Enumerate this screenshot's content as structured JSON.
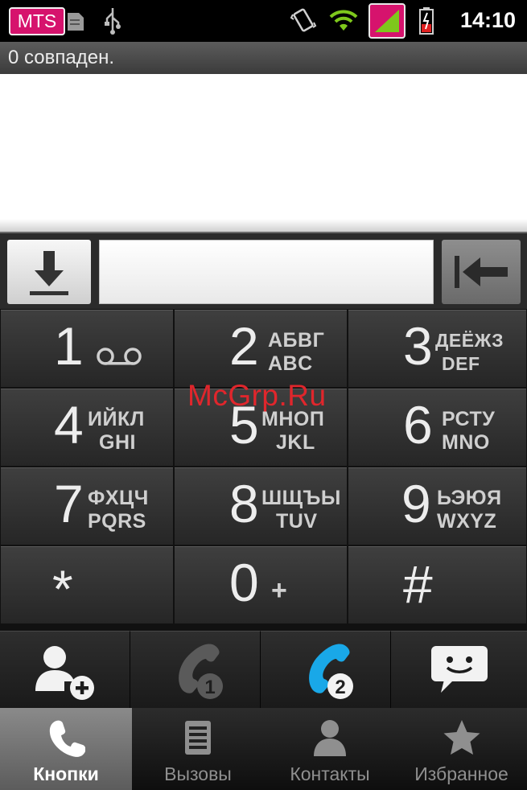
{
  "status_bar": {
    "carrier": "MTS",
    "time": "14:10",
    "icons": [
      "sd-card-icon",
      "usb-icon",
      "vibrate-icon",
      "wifi-icon",
      "signal-icon",
      "battery-charging-icon"
    ]
  },
  "search": {
    "matches_label": "0 совпаден.",
    "number_value": ""
  },
  "input_row": {
    "left_icon": "hide-keypad-icon",
    "right_icon": "backspace-icon"
  },
  "keypad": [
    {
      "digit": "1",
      "icon": "voicemail-icon"
    },
    {
      "digit": "2",
      "cyrillic": "АБВГ",
      "latin": "ABC"
    },
    {
      "digit": "3",
      "cyrillic": "ДЕЁЖЗ",
      "latin": "DEF"
    },
    {
      "digit": "4",
      "cyrillic": "ИЙКЛ",
      "latin": "GHI"
    },
    {
      "digit": "5",
      "cyrillic": "МНОП",
      "latin": "JKL"
    },
    {
      "digit": "6",
      "cyrillic": "РСТУ",
      "latin": "MNO"
    },
    {
      "digit": "7",
      "cyrillic": "ФХЦЧ",
      "latin": "PQRS"
    },
    {
      "digit": "8",
      "cyrillic": "ШЩЪЫ",
      "latin": "TUV"
    },
    {
      "digit": "9",
      "cyrillic": "ЬЭЮЯ",
      "latin": "WXYZ"
    },
    {
      "digit": "*"
    },
    {
      "digit": "0",
      "extra": "+"
    },
    {
      "digit": "#"
    }
  ],
  "actions": [
    {
      "icon": "add-contact-icon",
      "badge": ""
    },
    {
      "icon": "call-sim1-icon",
      "badge": "1"
    },
    {
      "icon": "call-sim2-icon",
      "badge": "2"
    },
    {
      "icon": "message-icon",
      "badge": ""
    }
  ],
  "tabs": [
    {
      "label": "Кнопки",
      "icon": "phone-icon",
      "active": true
    },
    {
      "label": "Вызовы",
      "icon": "call-log-icon",
      "active": false
    },
    {
      "label": "Контакты",
      "icon": "person-icon",
      "active": false
    },
    {
      "label": "Избранное",
      "icon": "star-icon",
      "active": false
    }
  ],
  "watermark": "McGrp.Ru",
  "colors": {
    "carrier_bg": "#d6136d",
    "sim2_call": "#19a8e8",
    "sim1_call": "#5a5a5a",
    "watermark": "#e0262c"
  }
}
